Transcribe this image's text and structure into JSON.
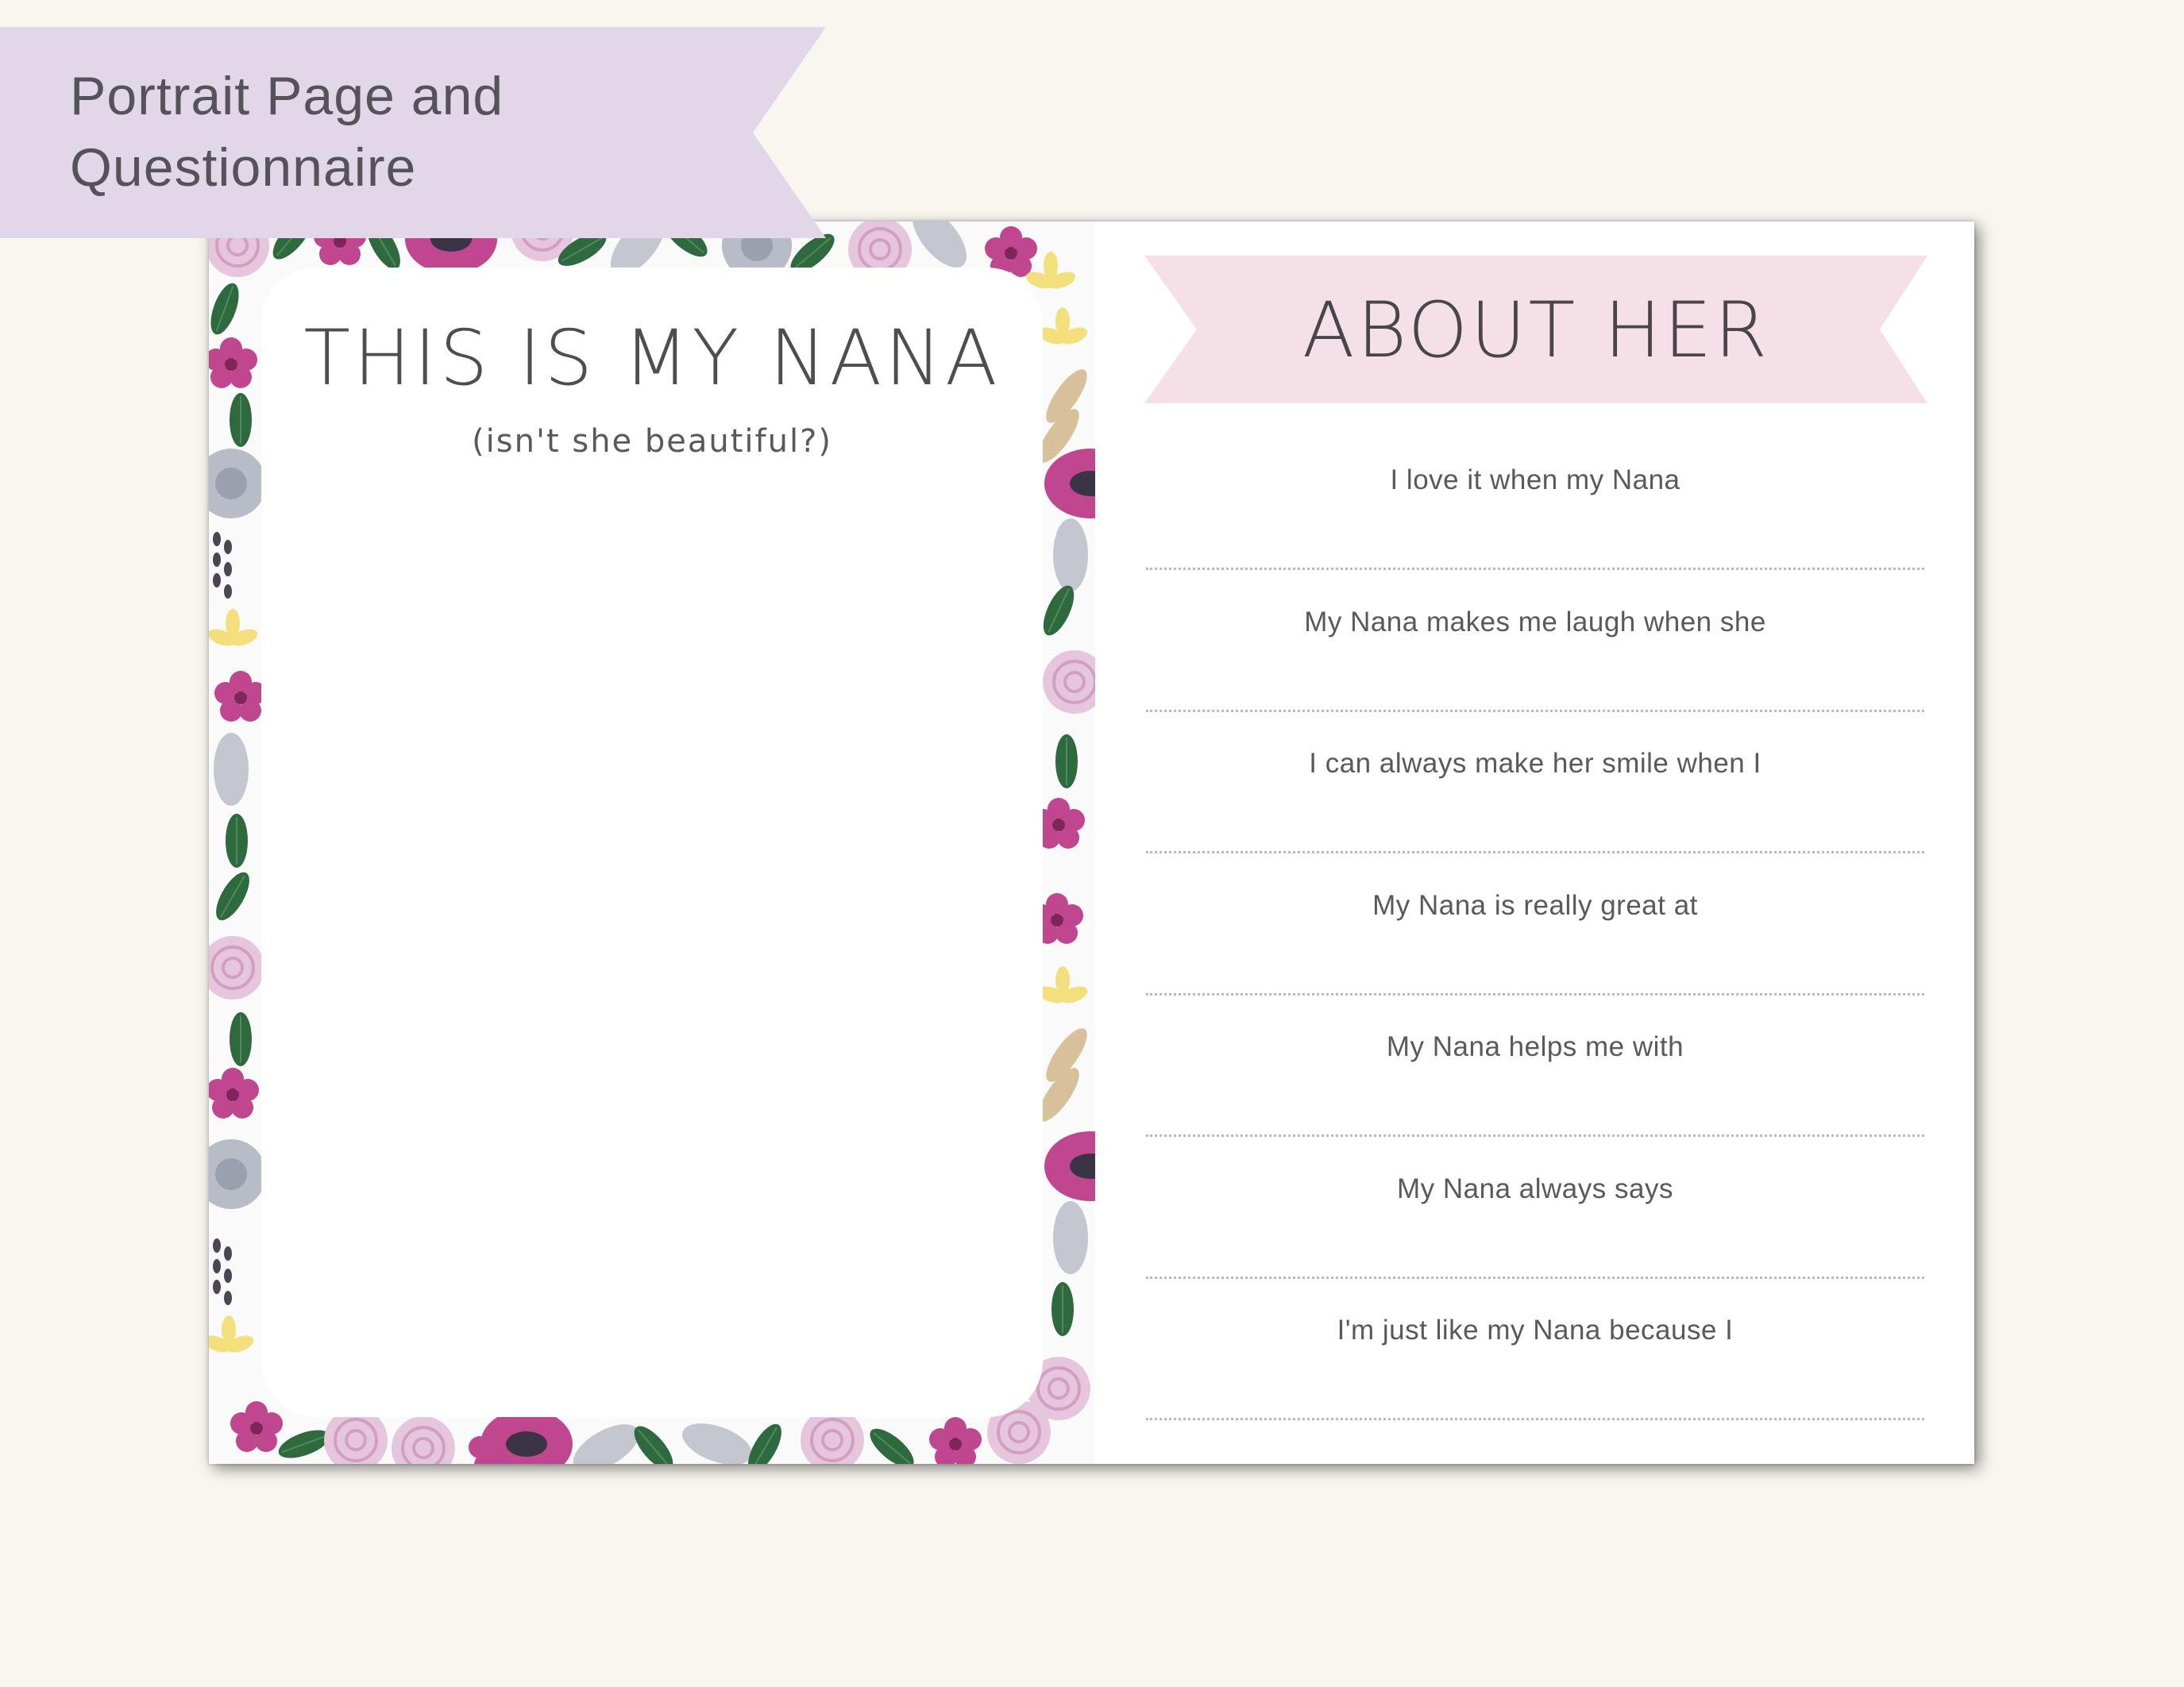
{
  "corner_banner": {
    "line1": "Portrait Page and",
    "line2": "Questionnaire",
    "color": "#e2d7e8"
  },
  "portrait_page": {
    "title": "THIS IS MY NANA",
    "subtitle": "(isn't she beautiful?)"
  },
  "about_page": {
    "title": "ABOUT HER",
    "banner_color": "#f6e0e7",
    "prompts": [
      "I love it when my Nana",
      "My Nana makes me laugh when she",
      "I can always make her smile when I",
      "My Nana is really great at",
      "My Nana helps me with",
      "My Nana always says",
      "I'm just like my Nana because I"
    ]
  },
  "palette": {
    "magenta": "#c0478f",
    "pink": "#e2b9d3",
    "lavender": "#c8b9d4",
    "green": "#2f6a3f",
    "grey": "#b8bcc6",
    "yellow": "#f3df7c",
    "tan": "#d7c09a",
    "dark": "#3a3446"
  }
}
